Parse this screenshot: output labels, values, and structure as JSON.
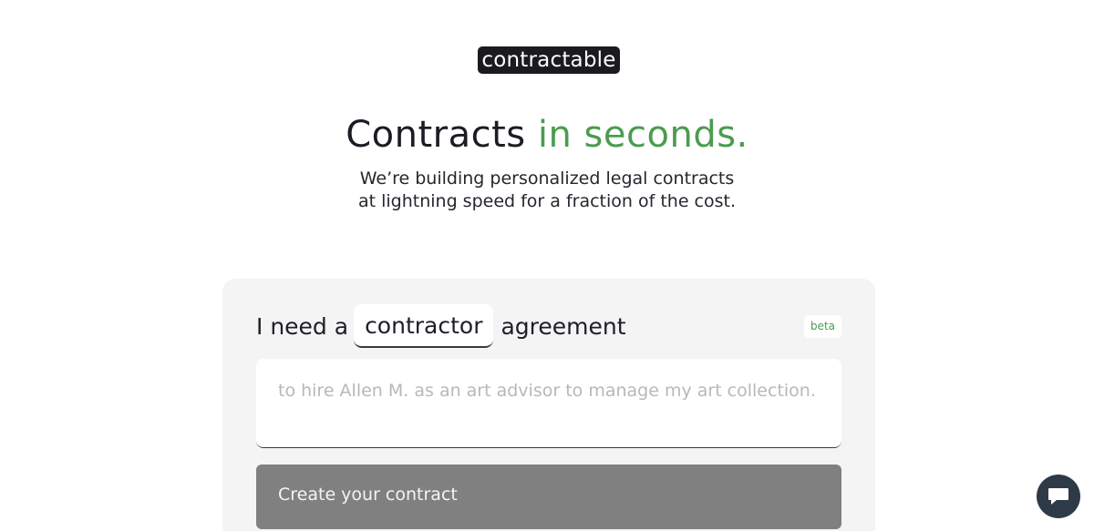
{
  "brand": {
    "logo_text": "contractable"
  },
  "hero": {
    "headline_main": "Contracts",
    "headline_accent": "in seconds.",
    "subhead_line1": "We’re building personalized legal contracts",
    "subhead_line2": "at lightning speed for a fraction of the cost."
  },
  "form": {
    "prefix": "I need a",
    "contract_type": "contractor",
    "suffix": "agreement",
    "badge": "beta",
    "description_placeholder": "to hire Allen M. as an art advisor to manage my art collection.",
    "submit_label": "Create your contract"
  },
  "chat": {
    "icon": "chat-bubble-icon"
  },
  "colors": {
    "accent": "#4a9c4f",
    "logo_bg": "#1b1b1f",
    "card_bg": "#f4f4f5",
    "button_bg": "#808080",
    "chat_bg": "#2e3a47"
  }
}
